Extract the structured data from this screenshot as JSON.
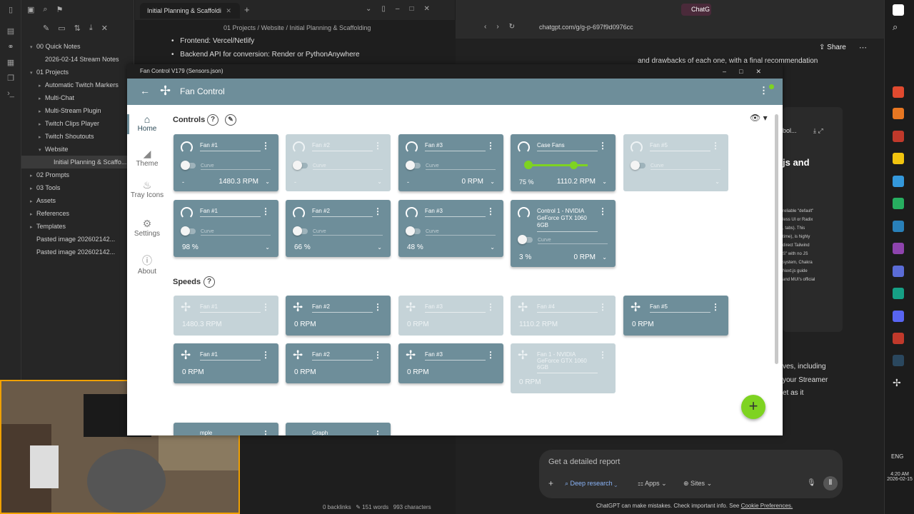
{
  "obsidian": {
    "tab_title": "Initial Planning & Scaffoldi",
    "breadcrumb": [
      "01 Projects",
      "/",
      "Website",
      "/",
      "Initial Planning & Scaffolding"
    ],
    "bullets": [
      "Frontend: Vercel/Netlify",
      "Backend API for conversion: Render or PythonAnywhere"
    ],
    "tree": [
      {
        "label": "00 Quick Notes",
        "indent": 0,
        "caret": "▾"
      },
      {
        "label": "2026-02-14 Stream Notes",
        "indent": 1,
        "caret": ""
      },
      {
        "label": "01 Projects",
        "indent": 0,
        "caret": "▾"
      },
      {
        "label": "Automatic Twitch Markers",
        "indent": 1,
        "caret": "▸"
      },
      {
        "label": "Multi-Chat",
        "indent": 1,
        "caret": "▸"
      },
      {
        "label": "Multi-Stream Plugin",
        "indent": 1,
        "caret": "▸"
      },
      {
        "label": "Twitch Clips Player",
        "indent": 1,
        "caret": "▸"
      },
      {
        "label": "Twitch Shoutouts",
        "indent": 1,
        "caret": "▸"
      },
      {
        "label": "Website",
        "indent": 1,
        "caret": "▾"
      },
      {
        "label": "Initial Planning & Scaffo...",
        "indent": 2,
        "caret": ""
      },
      {
        "label": "02 Prompts",
        "indent": 0,
        "caret": "▸"
      },
      {
        "label": "03 Tools",
        "indent": 0,
        "caret": "▸"
      },
      {
        "label": "Assets",
        "indent": 0,
        "caret": "▸"
      },
      {
        "label": "References",
        "indent": 0,
        "caret": "▸"
      },
      {
        "label": "Templates",
        "indent": 0,
        "caret": "▸"
      },
      {
        "label": "Pasted image 202602142...",
        "indent": 0,
        "caret": ""
      },
      {
        "label": "Pasted image 202602142...",
        "indent": 0,
        "caret": ""
      }
    ],
    "status": {
      "backlinks": "0 backlinks",
      "words": "151 words",
      "chars": "993 characters"
    }
  },
  "chrome": {
    "tab_title": "ChatG",
    "address": "chatgpt.com/g/g-p-697f9d0976cc",
    "share": "Share",
    "top_text": "and drawbacks of each one, with a final recommendation",
    "heading": "js and",
    "side_lines": [
      "reliable \"default\"",
      "less UI or Radix",
      ", tabs). This",
      "time), is highly",
      "direct Tailwind",
      "S\" with no JS",
      "system, Chakra",
      "Next.js guide",
      "and MUI's official"
    ],
    "bottom_lines": [
      "ves, including",
      "your Streamer",
      "et as it"
    ],
    "input_placeholder": "Get a detailed report",
    "chips": [
      "Deep research",
      "Apps",
      "Sites"
    ],
    "disclaimer": "ChatGPT can make mistakes. Check important info. See",
    "disclaimer_link": "Cookie Preferences."
  },
  "taskbar": {
    "lang": "ENG",
    "time": "4:20 AM",
    "date": "2026-02-15"
  },
  "fan_control": {
    "window_title": "Fan Control V179 (Sensors.json)",
    "app_title": "Fan Control",
    "nav": [
      "Home",
      "Theme",
      "Tray Icons",
      "Settings",
      "About"
    ],
    "controls_title": "Controls",
    "speeds_title": "Speeds",
    "curve_label": "Curve",
    "controls_row1": [
      {
        "name": "Fan #1",
        "value": "1480.3 RPM",
        "left": "-",
        "disabled": false
      },
      {
        "name": "Fan #2",
        "value": "",
        "left": "-",
        "disabled": true
      },
      {
        "name": "Fan #3",
        "value": "0 RPM",
        "left": "-",
        "disabled": false
      },
      {
        "name": "Case Fans",
        "value": "1110.2 RPM",
        "left": "75 %",
        "disabled": false,
        "slider": 0.75
      },
      {
        "name": "Fan #5",
        "value": "",
        "left": "",
        "disabled": true
      }
    ],
    "controls_row2": [
      {
        "name": "Fan #1",
        "pct": "98 %",
        "disabled": false
      },
      {
        "name": "Fan #2",
        "pct": "66 %",
        "disabled": false
      },
      {
        "name": "Fan #3",
        "pct": "48 %",
        "disabled": false
      },
      {
        "name": "Control 1 - NVIDIA GeForce GTX 1060 6GB",
        "pct": "3 %",
        "rpm": "0 RPM",
        "disabled": false
      }
    ],
    "speeds_row1": [
      {
        "name": "Fan #1",
        "speed": "1480.3 RPM",
        "disabled": true
      },
      {
        "name": "Fan #2",
        "speed": "0 RPM",
        "disabled": false
      },
      {
        "name": "Fan #3",
        "speed": "0 RPM",
        "disabled": true
      },
      {
        "name": "Fan #4",
        "speed": "1110.2 RPM",
        "disabled": true
      },
      {
        "name": "Fan #5",
        "speed": "0 RPM",
        "disabled": false
      }
    ],
    "speeds_row2": [
      {
        "name": "Fan #1",
        "speed": "0 RPM",
        "disabled": false
      },
      {
        "name": "Fan #2",
        "speed": "0 RPM",
        "disabled": false
      },
      {
        "name": "Fan #3",
        "speed": "0 RPM",
        "disabled": false
      },
      {
        "name": "Fan 1 - NVIDIA GeForce GTX 1060 6GB",
        "speed": "0 RPM",
        "disabled": true
      }
    ],
    "bottom_cards": [
      "mple",
      "Graph"
    ]
  }
}
